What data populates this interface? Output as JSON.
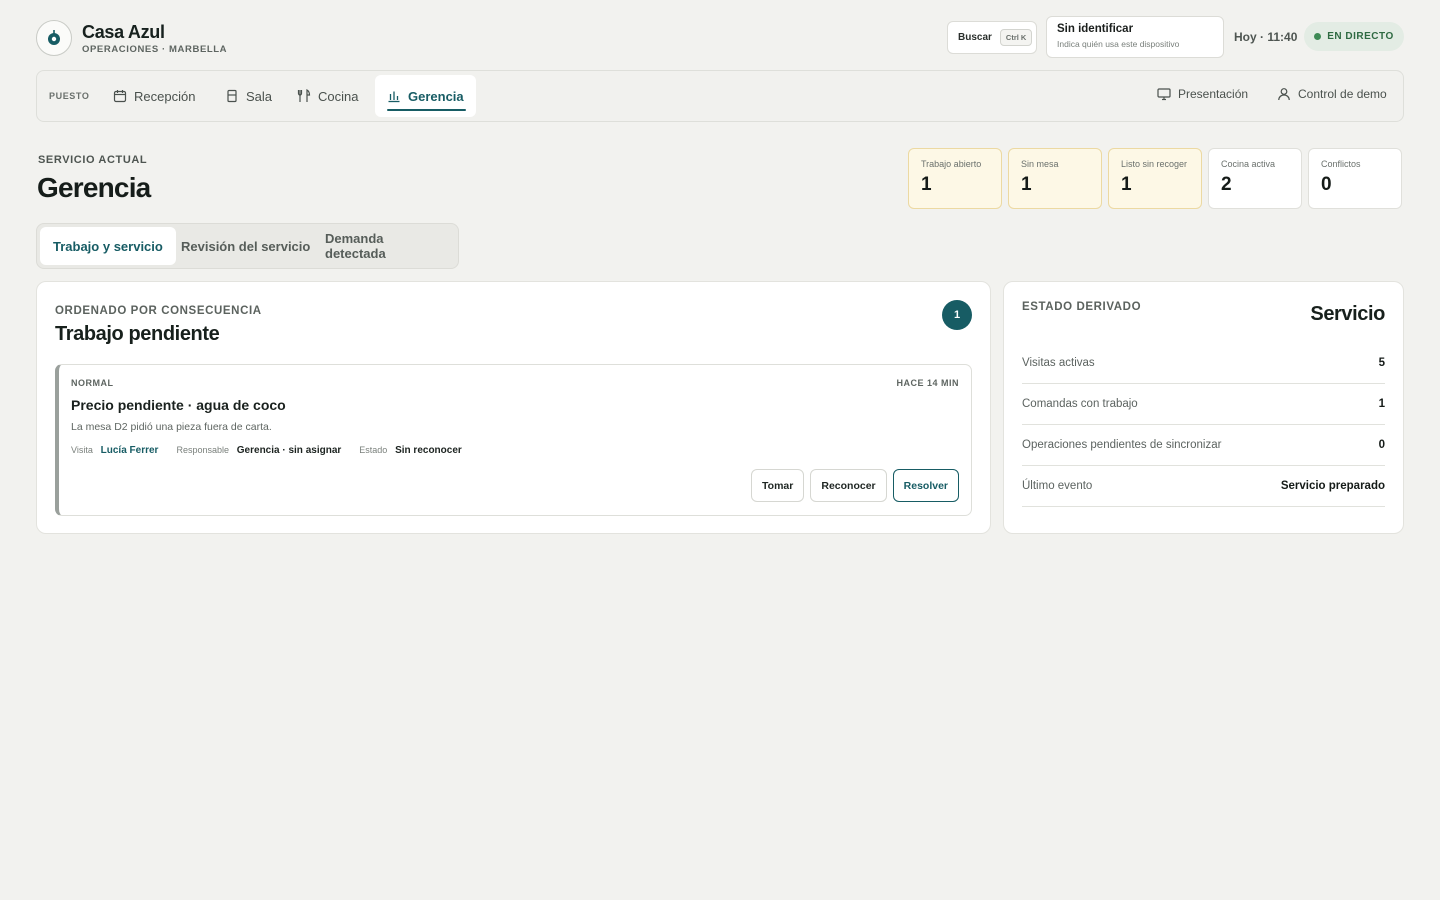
{
  "brand": {
    "name": "Casa Azul",
    "subtitle": "OPERACIONES · MARBELLA"
  },
  "header": {
    "search_label": "Buscar",
    "search_shortcut": "Ctrl K",
    "identity_title": "Sin identificar",
    "identity_hint": "Indica quién usa este dispositivo",
    "clock": "Hoy · 11:40",
    "live_label": "EN DIRECTO"
  },
  "nav": {
    "label": "PUESTO",
    "items": [
      {
        "label": "Recepción",
        "icon": "calendar-icon"
      },
      {
        "label": "Sala",
        "icon": "door-icon"
      },
      {
        "label": "Cocina",
        "icon": "utensils-icon"
      },
      {
        "label": "Gerencia",
        "icon": "bar-chart-icon",
        "active": true
      }
    ],
    "presentation_label": "Presentación",
    "demo_label": "Control de demo"
  },
  "page": {
    "eyebrow": "SERVICIO ACTUAL",
    "title": "Gerencia"
  },
  "kpis": [
    {
      "label": "Trabajo abierto",
      "value": "1",
      "tone": "warn"
    },
    {
      "label": "Sin mesa",
      "value": "1",
      "tone": "warn"
    },
    {
      "label": "Listo sin recoger",
      "value": "1",
      "tone": "warn"
    },
    {
      "label": "Cocina activa",
      "value": "2",
      "tone": "neutral"
    },
    {
      "label": "Conflictos",
      "value": "0",
      "tone": "neutral"
    }
  ],
  "tabs": [
    {
      "label": "Trabajo y servicio",
      "active": true
    },
    {
      "label": "Revisión del servicio"
    },
    {
      "label": "Demanda detectada"
    }
  ],
  "work": {
    "eyebrow": "ORDENADO POR CONSECUENCIA",
    "title": "Trabajo pendiente",
    "count": "1",
    "items": [
      {
        "priority": "NORMAL",
        "age": "HACE 14 MIN",
        "title": "Precio pendiente · agua de coco",
        "description": "La mesa D2 pidió una pieza fuera de carta.",
        "visit_key": "Visita",
        "visit_value": "Lucía Ferrer",
        "owner_key": "Responsable",
        "owner_value": "Gerencia · sin asignar",
        "status_key": "Estado",
        "status_value": "Sin reconocer",
        "actions": {
          "take": "Tomar",
          "acknowledge": "Reconocer",
          "resolve": "Resolver"
        }
      }
    ]
  },
  "state": {
    "eyebrow": "ESTADO DERIVADO",
    "title": "Servicio",
    "rows": [
      {
        "label": "Visitas activas",
        "value": "5"
      },
      {
        "label": "Comandas con trabajo",
        "value": "1"
      },
      {
        "label": "Operaciones pendientes de sincronizar",
        "value": "0"
      },
      {
        "label": "Último evento",
        "value": "Servicio preparado"
      }
    ]
  },
  "colors": {
    "accent": "#175c64",
    "live": "#3e8a55",
    "warn_bg": "#fdf8e6",
    "background": "#f2f2ef"
  }
}
